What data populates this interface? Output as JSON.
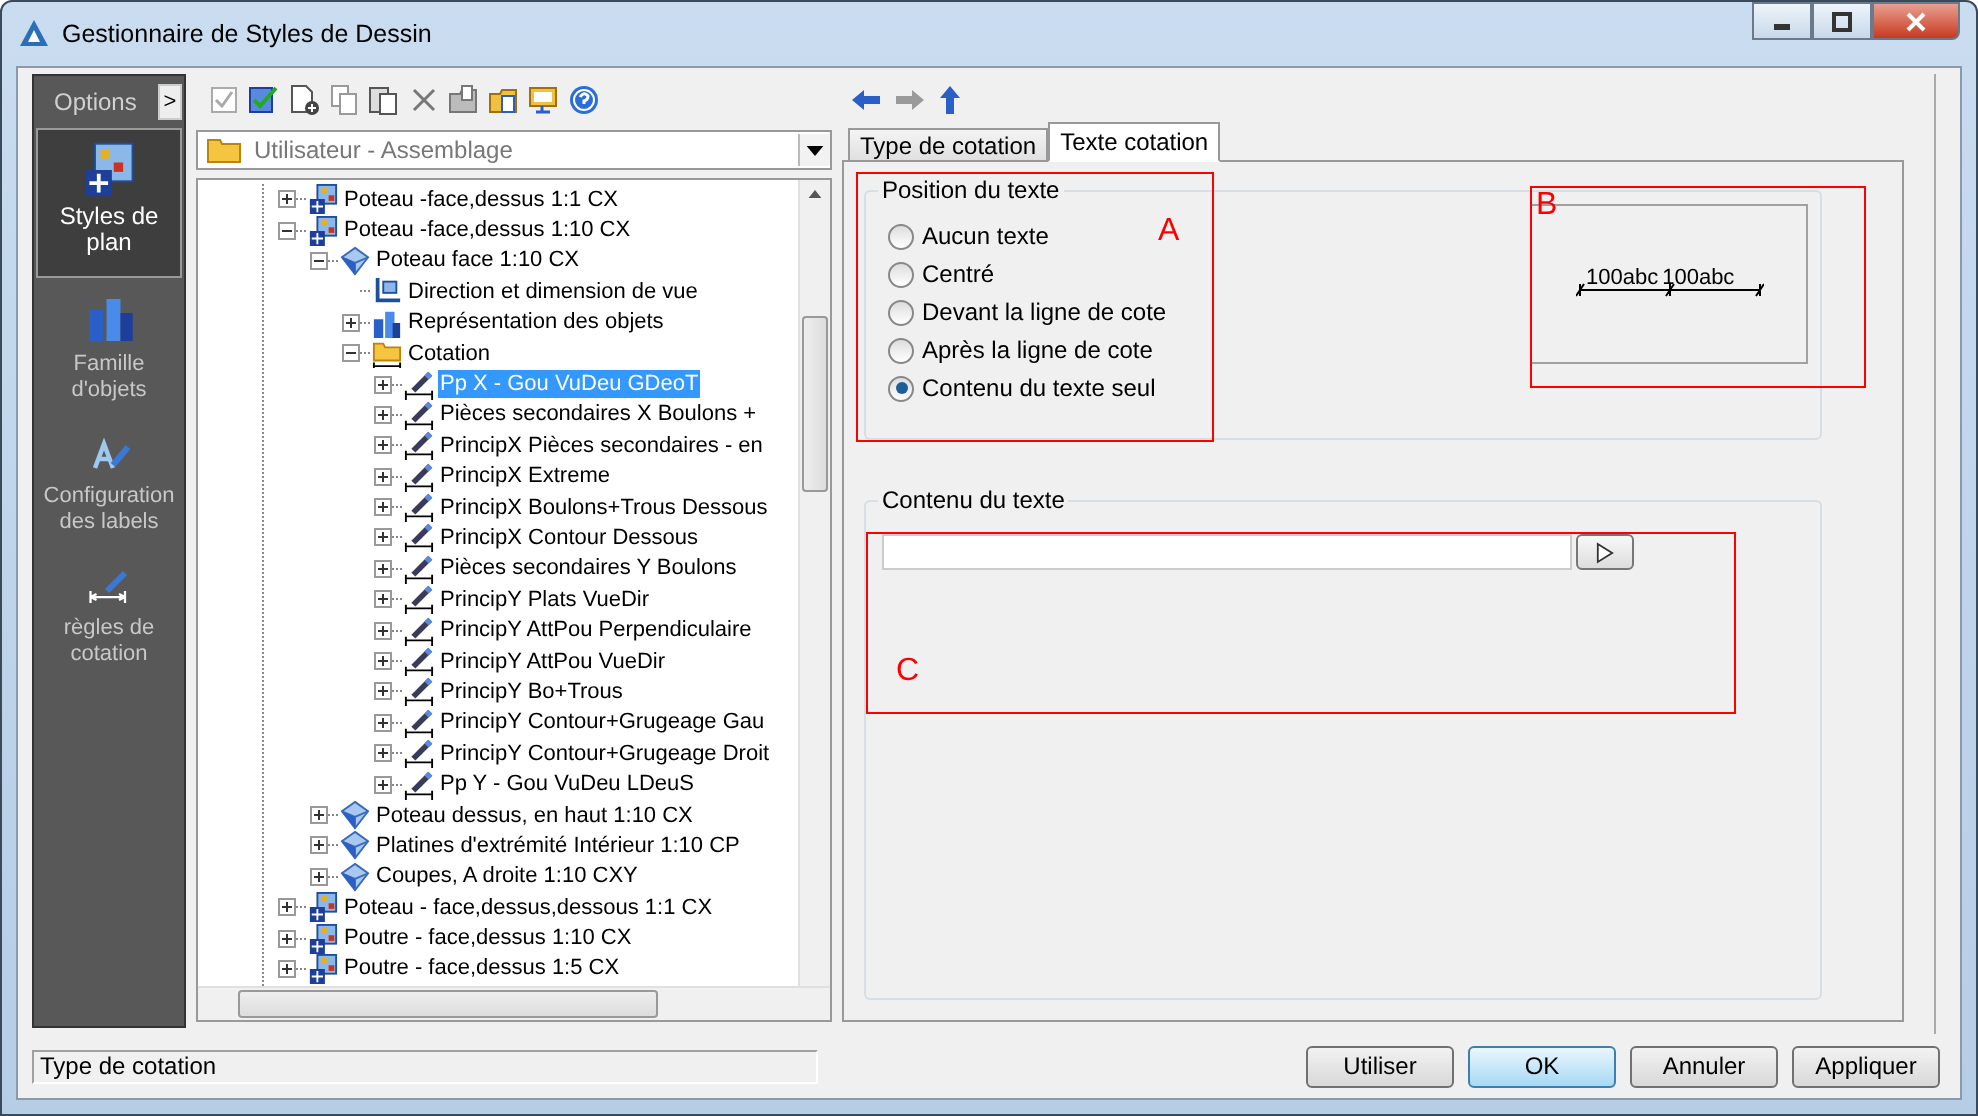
{
  "window": {
    "title": "Gestionnaire de Styles de Dessin"
  },
  "sidebar": {
    "header": "Options",
    "toggle": ">",
    "items": [
      {
        "label": "Styles de plan",
        "kind": "plan",
        "selected": true
      },
      {
        "label": "Famille d'objets",
        "kind": "family",
        "selected": false
      },
      {
        "label": "Configuration des labels",
        "kind": "labels",
        "selected": false
      },
      {
        "label": "règles de cotation",
        "kind": "rules",
        "selected": false
      }
    ]
  },
  "location": {
    "value": "Utilisateur - Assemblage"
  },
  "tree": {
    "items": [
      {
        "label": "Poteau -face,dessus 1:1 CX",
        "kind": "style",
        "expanded": false,
        "selected": false
      },
      {
        "label": "Poteau -face,dessus 1:10 CX",
        "kind": "style",
        "expanded": true,
        "selected": false,
        "children": [
          {
            "label": "Poteau face 1:10 CX",
            "kind": "view",
            "expanded": true,
            "selected": false,
            "children": [
              {
                "label": "Direction et dimension de vue",
                "kind": "direction",
                "selected": false
              },
              {
                "label": "Représentation des objets",
                "kind": "representation",
                "expanded": false,
                "selected": false
              },
              {
                "label": "Cotation",
                "kind": "folder",
                "expanded": true,
                "selected": false,
                "children": [
                  {
                    "label": "Pp X - Gou VuDeu GDeoT",
                    "kind": "dimension",
                    "expanded": false,
                    "selected": true
                  },
                  {
                    "label": "Pièces secondaires X Boulons +",
                    "kind": "dimension",
                    "expanded": false,
                    "selected": false
                  },
                  {
                    "label": "PrincipX Pièces secondaires - en",
                    "kind": "dimension",
                    "expanded": false,
                    "selected": false
                  },
                  {
                    "label": "PrincipX Extreme",
                    "kind": "dimension",
                    "expanded": false,
                    "selected": false
                  },
                  {
                    "label": "PrincipX Boulons+Trous Dessous",
                    "kind": "dimension",
                    "expanded": false,
                    "selected": false
                  },
                  {
                    "label": "PrincipX Contour Dessous",
                    "kind": "dimension",
                    "expanded": false,
                    "selected": false
                  },
                  {
                    "label": "Pièces secondaires Y Boulons",
                    "kind": "dimension",
                    "expanded": false,
                    "selected": false
                  },
                  {
                    "label": "PrincipY Plats VueDir",
                    "kind": "dimension",
                    "expanded": false,
                    "selected": false
                  },
                  {
                    "label": "PrincipY AttPou Perpendiculaire",
                    "kind": "dimension",
                    "expanded": false,
                    "selected": false
                  },
                  {
                    "label": "PrincipY AttPou VueDir",
                    "kind": "dimension",
                    "expanded": false,
                    "selected": false
                  },
                  {
                    "label": "PrincipY Bo+Trous",
                    "kind": "dimension",
                    "expanded": false,
                    "selected": false
                  },
                  {
                    "label": "PrincipY Contour+Grugeage Gau",
                    "kind": "dimension",
                    "expanded": false,
                    "selected": false
                  },
                  {
                    "label": "PrincipY Contour+Grugeage Droit",
                    "kind": "dimension",
                    "expanded": false,
                    "selected": false
                  },
                  {
                    "label": "Pp Y - Gou VuDeu LDeuS",
                    "kind": "dimension",
                    "expanded": false,
                    "selected": false
                  }
                ]
              }
            ]
          },
          {
            "label": "Poteau dessus, en haut 1:10 CX",
            "kind": "view",
            "expanded": false,
            "selected": false
          },
          {
            "label": "Platines d'extrémité Intérieur 1:10 CP",
            "kind": "view",
            "expanded": false,
            "selected": false
          },
          {
            "label": "Coupes, A droite 1:10 CXY",
            "kind": "view",
            "expanded": false,
            "selected": false
          }
        ]
      },
      {
        "label": "Poteau - face,dessus,dessous 1:1 CX",
        "kind": "style",
        "expanded": false,
        "selected": false
      },
      {
        "label": "Poutre - face,dessus 1:10 CX",
        "kind": "style",
        "expanded": false,
        "selected": false
      },
      {
        "label": "Poutre - face,dessus 1:5 CX",
        "kind": "style",
        "expanded": false,
        "selected": false
      }
    ]
  },
  "tabs": [
    {
      "label": "Type de cotation",
      "selected": false
    },
    {
      "label": "Texte cotation",
      "selected": true
    }
  ],
  "text_position": {
    "title": "Position du texte",
    "marker": "A",
    "options": [
      {
        "label": "Aucun texte",
        "selected": false
      },
      {
        "label": "Centré",
        "selected": false
      },
      {
        "label": "Devant la ligne de cote",
        "selected": false
      },
      {
        "label": "Après la ligne de cote",
        "selected": false
      },
      {
        "label": "Contenu du texte seul",
        "selected": true
      }
    ]
  },
  "preview": {
    "marker": "B",
    "labels": [
      "100abc",
      "100abc"
    ]
  },
  "text_content": {
    "title": "Contenu du texte",
    "marker": "C"
  },
  "buttons": [
    {
      "label": "Utiliser",
      "default": false
    },
    {
      "label": "OK",
      "default": true
    },
    {
      "label": "Annuler",
      "default": false
    },
    {
      "label": "Appliquer",
      "default": false
    }
  ],
  "status_bar": {
    "text": "Type de cotation"
  }
}
